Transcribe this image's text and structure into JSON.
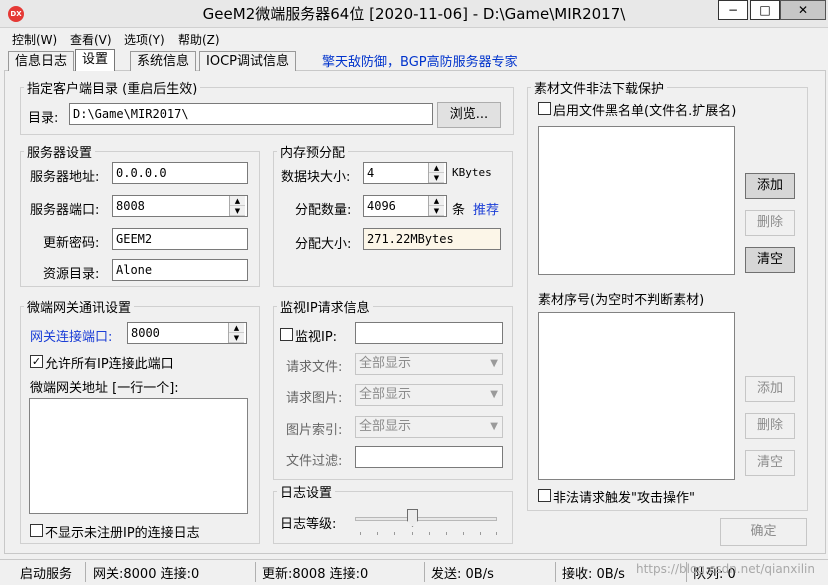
{
  "window": {
    "title": "GeeM2微端服务器64位 [2020-11-06] - D:\\Game\\MIR2017\\",
    "icon_text": "DX",
    "minimize": "−",
    "maximize": "□",
    "close": "✕"
  },
  "menu": [
    "控制(W)",
    "查看(V)",
    "选项(Y)",
    "帮助(Z)"
  ],
  "tabs": [
    "信息日志",
    "设置",
    "系统信息",
    "IOCP调试信息"
  ],
  "active_tab": "设置",
  "promo": "擎天敌防御，BGP高防服务器专家",
  "client_dir": {
    "legend": "指定客户端目录 (重启后生效)",
    "label": "目录:",
    "value": "D:\\Game\\MIR2017\\",
    "browse": "浏览..."
  },
  "server": {
    "legend": "服务器设置",
    "address_label": "服务器地址:",
    "address": "0.0.0.0",
    "port_label": "服务器端口:",
    "port": "8008",
    "password_label": "更新密码:",
    "password": "GEEM2",
    "resdir_label": "资源目录:",
    "resdir": "Alone"
  },
  "memory": {
    "legend": "内存预分配",
    "block_label": "数据块大小:",
    "block": "4",
    "block_unit": "KBytes",
    "count_label": "分配数量:",
    "count": "4096",
    "count_unit": "条",
    "recommend": "推荐",
    "size_label": "分配大小:",
    "size": "271.22MBytes"
  },
  "gateway": {
    "legend": "微端网关通讯设置",
    "port_label": "网关连接端口:",
    "port": "8000",
    "allow_all": "允许所有IP连接此端口",
    "addr_label": "微端网关地址 [一行一个]:",
    "hide_unregistered": "不显示未注册IP的连接日志"
  },
  "monitor": {
    "legend": "监视IP请求信息",
    "ip_label": "监视IP:",
    "file_label": "请求文件:",
    "file_value": "全部显示",
    "image_label": "请求图片:",
    "image_value": "全部显示",
    "index_label": "图片索引:",
    "index_value": "全部显示",
    "filter_label": "文件过滤:"
  },
  "log": {
    "legend": "日志设置",
    "level_label": "日志等级:",
    "level_fraction": 0.4
  },
  "protect": {
    "legend": "素材文件非法下载保护",
    "blacklist": "启用文件黑名单(文件名.扩展名)",
    "add": "添加",
    "delete": "删除",
    "clear": "清空",
    "serial_label": "素材序号(为空时不判断素材)",
    "add2": "添加",
    "delete2": "删除",
    "clear2": "清空",
    "attack": "非法请求触发\"攻击操作\""
  },
  "ok_button": "确定",
  "status": {
    "service": "启动服务",
    "gateway": "网关:8000  连接:0",
    "update": "更新:8008  连接:0",
    "send": "发送: 0B/s",
    "recv": "接收: 0B/s",
    "queue": "队列: 0"
  },
  "watermark": "https://blog.csdn.net/qianxilin"
}
